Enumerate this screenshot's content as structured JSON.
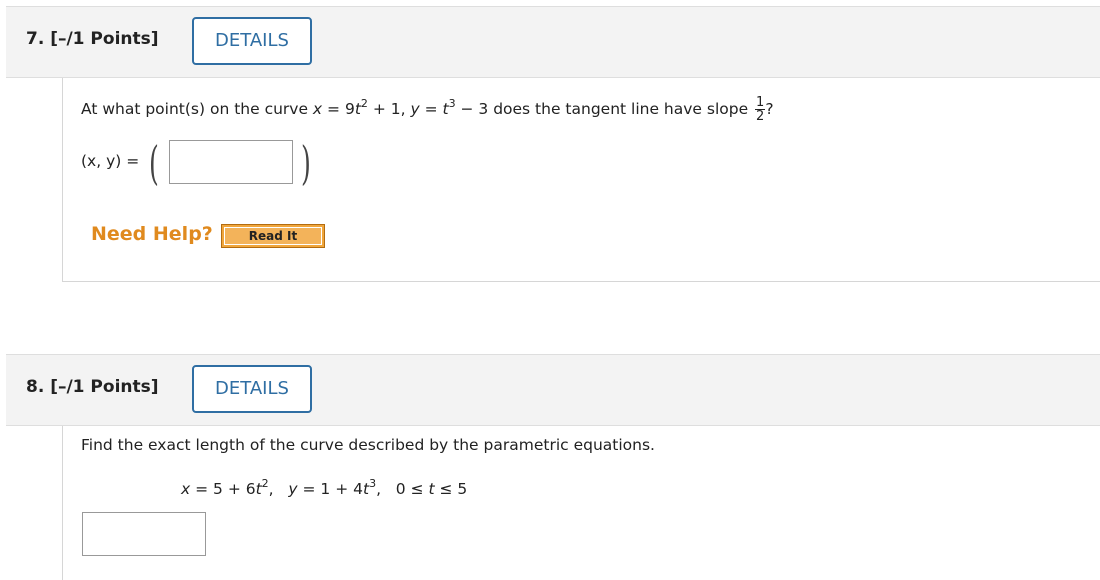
{
  "q7": {
    "number_label": "7. [–/1 Points]",
    "details_label": "DETAILS",
    "prompt_start": "At what point(s) on the curve ",
    "x_var": "x",
    "eq1_mid": " = 9",
    "t_var": "t",
    "exp2": "2",
    "eq1_end": " + 1, ",
    "y_var": "y",
    "eq2_mid": " = ",
    "exp3": "3",
    "eq2_end": " − 3 does the tangent line have slope ",
    "slope_num": "1",
    "slope_den": "2",
    "prompt_end": "?",
    "answer_label": "(x, y) = ",
    "answer_value": "",
    "need_help": "Need Help?",
    "read_it": "Read It"
  },
  "q8": {
    "number_label": "8. [–/1 Points]",
    "details_label": "DETAILS",
    "prompt": "Find the exact length of the curve described by the parametric equations.",
    "eq_x_a": "x",
    "eq_x_b": " = 5 + 6",
    "eq_x_t": "t",
    "eq_x_exp": "2",
    "eq_x_c": ",   ",
    "eq_y_a": "y",
    "eq_y_b": " = 1 + 4",
    "eq_y_t": "t",
    "eq_y_exp": "3",
    "eq_y_c": ",   ",
    "range_a": "0 ≤ ",
    "range_t": "t",
    "range_b": " ≤ 5",
    "answer_value": ""
  }
}
